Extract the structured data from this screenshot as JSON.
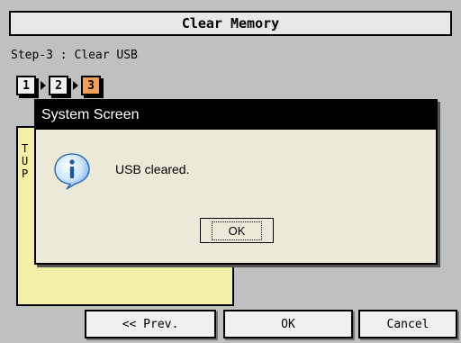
{
  "window": {
    "title": "Clear Memory"
  },
  "step_header": "Step-3 : Clear USB",
  "steps": [
    {
      "label": "1",
      "active": false
    },
    {
      "label": "2",
      "active": false
    },
    {
      "label": "3",
      "active": true
    }
  ],
  "info_panel": {
    "text": "T\nU\nP"
  },
  "buttons": {
    "prev": "<< Prev.",
    "ok": "OK",
    "cancel": "Cancel"
  },
  "dialog": {
    "title": "System Screen",
    "message": "USB cleared.",
    "ok_label": "OK",
    "icon": "info-icon"
  },
  "colors": {
    "background": "#c0c0c0",
    "active_step": "#f2a058",
    "info_panel": "#f2f0a8",
    "dialog_title": "#000000"
  }
}
